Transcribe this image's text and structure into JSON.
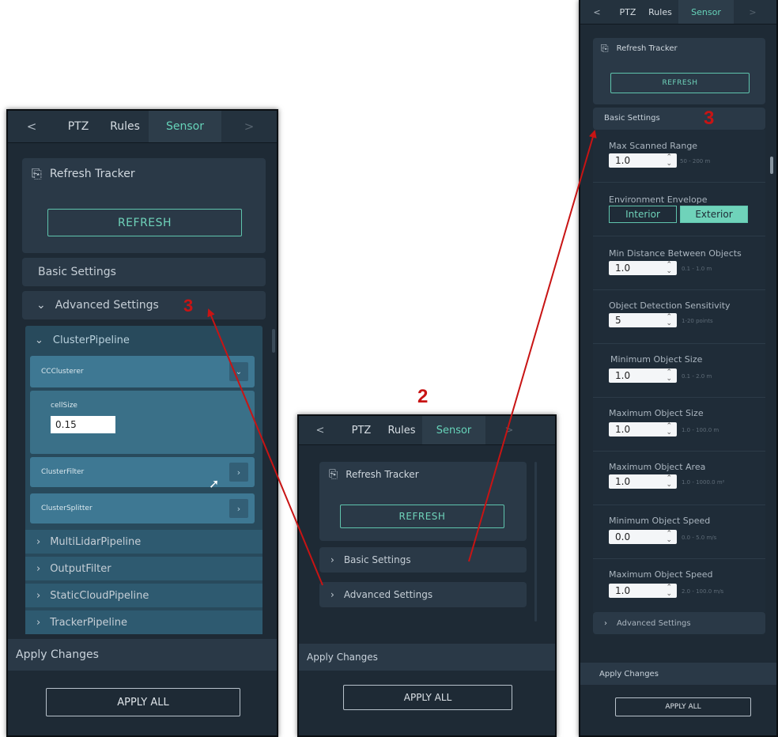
{
  "tabs": {
    "back": "<",
    "forward": ">",
    "ptz": "PTZ",
    "rules": "Rules",
    "sensor": "Sensor"
  },
  "refresh_tracker": {
    "title": "Refresh Tracker",
    "icon": "tracker-icon",
    "button": "REFRESH"
  },
  "sections": {
    "basic": "Basic Settings",
    "advanced": "Advanced Settings"
  },
  "advanced_tree": {
    "cluster_pipeline": "ClusterPipeline",
    "cc_clusterer": "CCClusterer",
    "cell_size_label": "cellSize",
    "cell_size_value": "0.15",
    "cluster_filter": "ClusterFilter",
    "cluster_splitter": "ClusterSplitter",
    "multi_lidar": "MultiLidarPipeline",
    "output_filter": "OutputFilter",
    "static_cloud": "StaticCloudPipeline",
    "tracker_pipeline": "TrackerPipeline"
  },
  "apply": {
    "title": "Apply Changes",
    "button": "APPLY ALL"
  },
  "basic_settings": {
    "max_scanned_range": {
      "label": "Max Scanned Range",
      "value": "1.0",
      "hint": "50 - 200 m"
    },
    "environment_envelope": {
      "label": "Environment Envelope",
      "interior": "Interior",
      "exterior": "Exterior",
      "selected": "Exterior"
    },
    "min_distance": {
      "label": "Min Distance Between Objects",
      "value": "1.0",
      "hint": "0.1 - 1.0 m"
    },
    "detection_sensitivity": {
      "label": "Object Detection Sensitivity",
      "value": "5",
      "hint": "1-20 points"
    },
    "min_object_size": {
      "label": "Minimum Object Size",
      "value": "1.0",
      "hint": "0.1 - 2.0 m"
    },
    "max_object_size": {
      "label": "Maximum Object Size",
      "value": "1.0",
      "hint": "1.0 - 100.0 m"
    },
    "max_object_area": {
      "label": "Maximum Object Area",
      "value": "1.0",
      "hint": "1.0 - 1000.0 m²"
    },
    "min_object_speed": {
      "label": "Minimum Object Speed",
      "value": "0.0",
      "hint": "0.0 - 5.0 m/s"
    },
    "max_object_speed": {
      "label": "Maximum Object Speed",
      "value": "1.0",
      "hint": "2.0 - 100.0 m/s"
    }
  },
  "annotations": {
    "step2": "2",
    "step3_left": "3",
    "step3_right": "3"
  },
  "colors": {
    "panel_bg": "#1e2a35",
    "accent": "#6fd3ba",
    "arrow_red": "#c81414"
  }
}
